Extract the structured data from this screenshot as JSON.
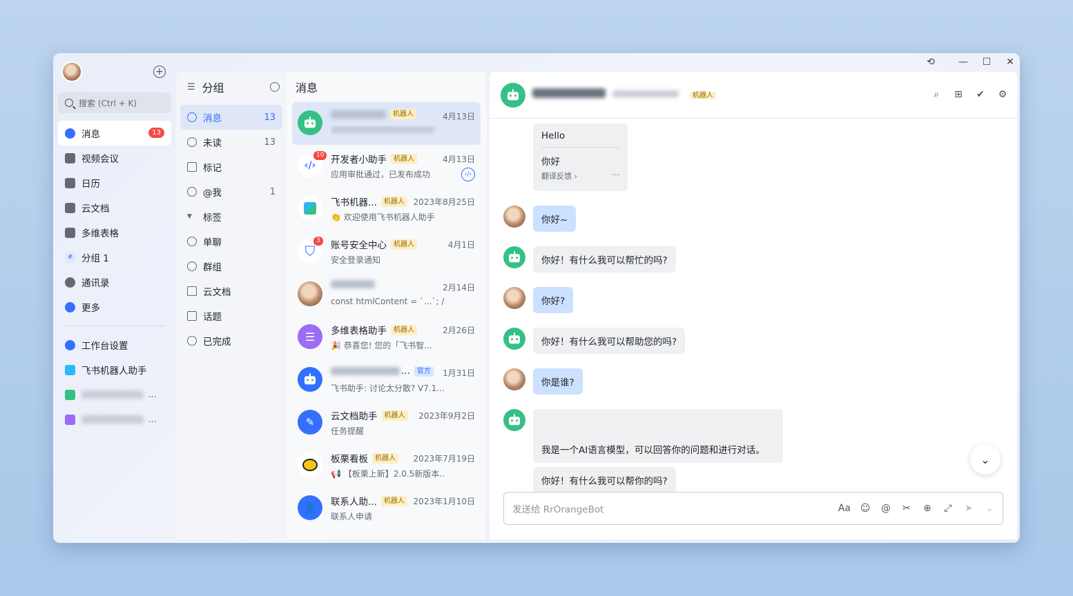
{
  "nav": {
    "search_placeholder": "搜索 (Ctrl + K)",
    "items": [
      {
        "label": "消息",
        "badge": "13",
        "icon": "chat-bubble-icon",
        "color": "#3370ff"
      },
      {
        "label": "视频会议",
        "icon": "video-camera-icon",
        "color": "#646a73"
      },
      {
        "label": "日历",
        "icon": "calendar-icon",
        "color": "#646a73"
      },
      {
        "label": "云文档",
        "icon": "cloud-doc-icon",
        "color": "#646a73"
      },
      {
        "label": "多维表格",
        "icon": "table-icon",
        "color": "#646a73"
      },
      {
        "label": "分组 1",
        "icon": "grid-icon",
        "color": "#3370ff"
      },
      {
        "label": "通讯录",
        "icon": "contacts-icon",
        "color": "#646a73"
      },
      {
        "label": "更多",
        "icon": "more-apps-icon",
        "color": "#3370ff"
      }
    ],
    "pinned": [
      {
        "label": "工作台设置",
        "icon": "gear-icon",
        "color": "#3370ff"
      },
      {
        "label": "飞书机器人助手",
        "icon": "bot-assistant-icon",
        "color": "#2db7f5"
      },
      {
        "label": "...",
        "icon": "app-green-icon",
        "color": "#34c186"
      },
      {
        "label": "...",
        "icon": "app-purple-icon",
        "color": "#9b6cf5"
      }
    ]
  },
  "groups": {
    "title": "分组",
    "items": [
      {
        "label": "消息",
        "count": "13",
        "active": true
      },
      {
        "label": "未读",
        "count": "13"
      },
      {
        "label": "标记",
        "count": ""
      },
      {
        "label": "@我",
        "count": "1"
      },
      {
        "label": "标签",
        "count": ""
      },
      {
        "label": "单聊",
        "count": ""
      },
      {
        "label": "群组",
        "count": ""
      },
      {
        "label": "云文档",
        "count": ""
      },
      {
        "label": "话题",
        "count": ""
      },
      {
        "label": "已完成",
        "count": ""
      }
    ]
  },
  "messages": {
    "title": "消息",
    "conversations": [
      {
        "name": "",
        "tag": "机器人",
        "date": "4月13日",
        "preview": "",
        "color": "#34c186",
        "active": true
      },
      {
        "name": "开发者小助手",
        "tag": "机器人",
        "date": "4月13日",
        "preview": "应用审批通过，已发布成功",
        "color": "#3370ff",
        "badge": "10"
      },
      {
        "name": "飞书机器...",
        "tag": "机器人",
        "date": "2023年8月25日",
        "preview": "👏 欢迎使用飞书机器人助手",
        "color": "#2db7f5"
      },
      {
        "name": "账号安全中心",
        "tag": "机器人",
        "date": "4月1日",
        "preview": "安全登录通知",
        "color": "#3370ff",
        "badge": "3"
      },
      {
        "name": "",
        "tag": "",
        "date": "2月14日",
        "preview": "const htmlContent = `...`; /...",
        "color": "#b98a68"
      },
      {
        "name": "多维表格助手",
        "tag": "机器人",
        "date": "2月26日",
        "preview": "🎉 恭喜您! 您的「飞书智...",
        "color": "#9b6cf5"
      },
      {
        "name": "...",
        "tag": "官方",
        "date": "1月31日",
        "preview": "飞书助手: 讨论太分散? V7.1...",
        "color": "#3370ff"
      },
      {
        "name": "云文档助手",
        "tag": "机器人",
        "date": "2023年9月2日",
        "preview": "任务提醒",
        "color": "#3370ff"
      },
      {
        "name": "板栗看板",
        "tag": "机器人",
        "date": "2023年7月19日",
        "preview": "📢 【板栗上新】2.0.5新版本...",
        "color": "#f5c518"
      },
      {
        "name": "联系人助...",
        "tag": "机器人",
        "date": "2023年1月10日",
        "preview": "联系人申请",
        "color": "#3370ff"
      }
    ]
  },
  "chat": {
    "name": "",
    "tag": "机器人",
    "translation_card": {
      "original": "Hello",
      "translated": "你好",
      "feedback": "翻译反馈 ›",
      "more": "···"
    },
    "bubbles": [
      {
        "from": "me",
        "text": "你好~"
      },
      {
        "from": "bot",
        "text": "你好！有什么我可以帮忙的吗?"
      },
      {
        "from": "me",
        "text": "你好?"
      },
      {
        "from": "bot",
        "text": "你好！有什么我可以帮助您的吗?"
      },
      {
        "from": "me",
        "text": "你是谁?"
      },
      {
        "from": "bot",
        "text": "我是一个AI语言模型，可以回答你的问题和进行对话。"
      },
      {
        "from": "bot",
        "text": "你好！有什么我可以帮你的吗?"
      }
    ],
    "composer_placeholder": "发送给 RrOrangeBot",
    "tools": {
      "font": "Aa",
      "emoji": "☺",
      "mention": "@",
      "scissors": "✂",
      "plus": "⊕",
      "expand": "⤢",
      "send": "➤",
      "dropdown": "⌄"
    }
  }
}
